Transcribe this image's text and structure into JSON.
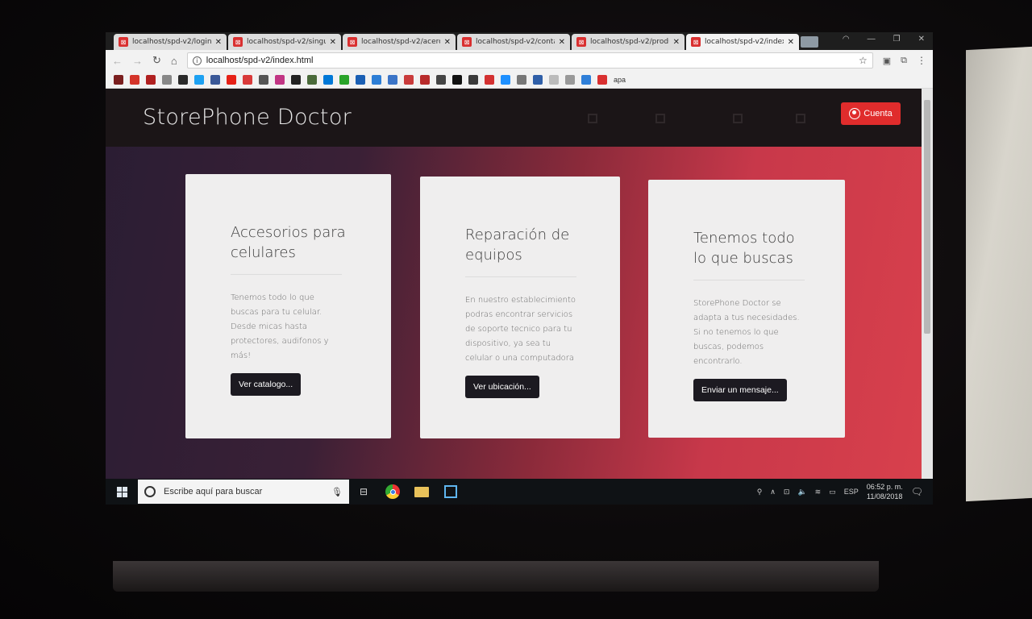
{
  "browser": {
    "tabs": [
      {
        "title": "localhost/spd-v2/login.h"
      },
      {
        "title": "localhost/spd-v2/singup"
      },
      {
        "title": "localhost/spd-v2/acerca"
      },
      {
        "title": "localhost/spd-v2/contac"
      },
      {
        "title": "localhost/spd-v2/produ"
      },
      {
        "title": "localhost/spd-v2/index",
        "active": true
      }
    ],
    "tab_close": "✕",
    "favicon": "⊠",
    "address": "localhost/spd-v2/index.html",
    "bookmark_label": "apa",
    "bookmark_colors": [
      "#7a1f1f",
      "#d4342a",
      "#b02020",
      "#888888",
      "#2a2a2a",
      "#1da1f2",
      "#3b5998",
      "#e62117",
      "#d93a3a",
      "#555555",
      "#c13584",
      "#222222",
      "#4a6a3a",
      "#0078d7",
      "#29a329",
      "#1a5fb4",
      "#2d7ed6",
      "#3b74c7",
      "#c93b3b",
      "#b82b2b",
      "#444444",
      "#111111",
      "#3a3a3a",
      "#d33131",
      "#1e90ff",
      "#777777",
      "#2f5fa8",
      "#bbbbbb",
      "#999999",
      "#2f7fd8",
      "#d93030"
    ]
  },
  "site": {
    "brand": "StorePhone Doctor",
    "account_button": "Cuenta",
    "cards": [
      {
        "title_line1": "Accesorios para",
        "title_line2": "celulares",
        "text": "Tenemos todo lo que buscas para tu celular. Desde micas hasta protectores, audifonos y más!",
        "button": "Ver catalogo..."
      },
      {
        "title_line1": "Reparación de",
        "title_line2": "equipos",
        "text": "En nuestro establecimiento podras encontrar servicios de soporte tecnico para tu dispositivo, ya sea tu celular o una computadora",
        "button": "Ver ubicación..."
      },
      {
        "title_line1": "Tenemos todo",
        "title_line2": "lo que buscas",
        "text": "StorePhone Doctor se adapta a tus necesidades. Si no tenemos lo que buscas, podemos encontrarlo.",
        "button": "Enviar un mensaje..."
      }
    ]
  },
  "taskbar": {
    "search_placeholder": "Escribe aquí para buscar",
    "language": "ESP",
    "time": "06:52 p. m.",
    "date": "11/08/2018"
  },
  "colors": {
    "accent": "#e02c2c",
    "card_bg": "#efeeee",
    "button_dark": "#1c1a21"
  }
}
